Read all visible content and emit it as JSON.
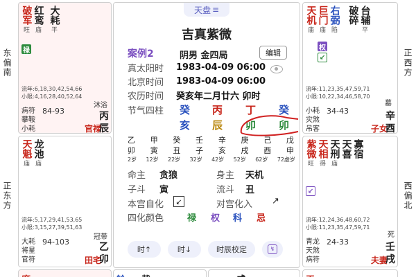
{
  "side_labels": {
    "top_left": "东偏南",
    "mid_left": "正东方",
    "top_right": "正西方",
    "mid_right": "西偏北"
  },
  "palaces": {
    "tl": {
      "stars": [
        {
          "ch": "破军",
          "b": "旺",
          "c": "red"
        },
        {
          "ch": "红鸾",
          "b": "庙",
          "c": "dark"
        },
        {
          "ch": "大耗",
          "b": "平",
          "c": "dark"
        }
      ],
      "tag": "禄",
      "limit1": "流年:6,18,30,42,54,66",
      "limit2": "小限:4,16,28,40,52,64",
      "minor1": "病符",
      "minor2": "攀鞍",
      "minor3": "小耗",
      "range": "84-93",
      "state": "沐浴",
      "name": "官禄",
      "gz1": "丙",
      "gz2": "辰"
    },
    "ml": {
      "stars": [
        {
          "ch": "天魁",
          "b": "庙",
          "c": "red"
        },
        {
          "ch": "龙池",
          "b": "庙",
          "c": "dark"
        }
      ],
      "limit1": "流年:5,17,29,41,53,65",
      "limit2": "小限:3,15,27,39,51,63",
      "minor1": "大耗",
      "minor2": "将星",
      "minor3": "官符",
      "range": "94-103",
      "state": "冠带",
      "name": "田宅",
      "gz1": "乙",
      "gz2": "卯"
    },
    "tr": {
      "stars": [
        {
          "ch": "天机",
          "b": "庙",
          "c": "red"
        },
        {
          "ch": "巨门",
          "b": "庙",
          "c": "red"
        },
        {
          "ch": "右弼",
          "b": "陷",
          "c": "blue"
        },
        {
          "ch": "破碎",
          "b": "",
          "c": "dark"
        },
        {
          "ch": "台辅",
          "b": "平",
          "c": "dark"
        }
      ],
      "tag": "权",
      "limit1": "流年:11,23,35,47,59,71",
      "limit2": "小限:10,22,34,46,58,70",
      "minor1": "小耗",
      "minor2": "灾煞",
      "minor3": "吊客",
      "range": "34-43",
      "state": "墓",
      "name": "子女",
      "gz1": "辛",
      "gz2": "酉"
    },
    "mr": {
      "stars": [
        {
          "ch": "紫微",
          "b": "旺",
          "c": "red"
        },
        {
          "ch": "天相",
          "b": "得",
          "c": "red"
        },
        {
          "ch": "天刑",
          "b": "庙",
          "c": "dark"
        },
        {
          "ch": "天喜",
          "b": "",
          "c": "dark"
        },
        {
          "ch": "寡宿",
          "b": "",
          "c": "dark"
        }
      ],
      "limit1": "流年:12,24,36,48,60,72",
      "limit2": "小限:11,23,35,47,59,71",
      "minor1": "青龙",
      "minor2": "天煞",
      "minor3": "病符",
      "range": "24-33",
      "state": "死",
      "name": "夫妻",
      "gz1": "壬",
      "gz2": "戌"
    },
    "bottom": {
      "bl1": "廉",
      "bl2": "铃",
      "bl3": "截",
      "br1": "咸",
      "br2": "天"
    }
  },
  "center": {
    "tab": "天盘",
    "title": "吉真紫微",
    "case": "案例2",
    "gender": "阴男 金四局",
    "edit": "编辑",
    "rows": [
      {
        "k": "真太阳时",
        "v": "1983-04-09 06:00"
      },
      {
        "k": "北京时间",
        "v": "1983-04-09 06:00"
      },
      {
        "k": "农历时间",
        "v": "癸亥年二月廿六 卯时"
      }
    ],
    "pillar_label": "节气四柱",
    "pillars_top": [
      "癸",
      "丙",
      "丁",
      "癸"
    ],
    "pillars_bot": [
      "亥",
      "辰",
      "卯",
      "卯"
    ],
    "grid_r1": [
      "乙",
      "甲",
      "癸",
      "壬",
      "辛",
      "庚",
      "己",
      "戊"
    ],
    "grid_r2": [
      "卯",
      "寅",
      "丑",
      "子",
      "亥",
      "戌",
      "酉",
      "申"
    ],
    "grid_r3": [
      "2岁",
      "12岁",
      "22岁",
      "32岁",
      "42岁",
      "52岁",
      "62岁",
      "72虚岁"
    ],
    "minggong_k": "命主",
    "minggong_v": "贪狼",
    "shengong_k": "身主",
    "shengong_v": "天机",
    "zidou_k": "子斗",
    "zidou_v": "寅",
    "liudou_k": "流斗",
    "liudou_v": "丑",
    "benggong_k": "本宫自化",
    "duigong_k": "对宫化入",
    "sihua_k": "四化颜色",
    "sihua": [
      "禄",
      "权",
      "科",
      "忌"
    ],
    "btn_prev": "时↑",
    "btn_next": "时↓",
    "btn_correct": "时辰校定"
  }
}
